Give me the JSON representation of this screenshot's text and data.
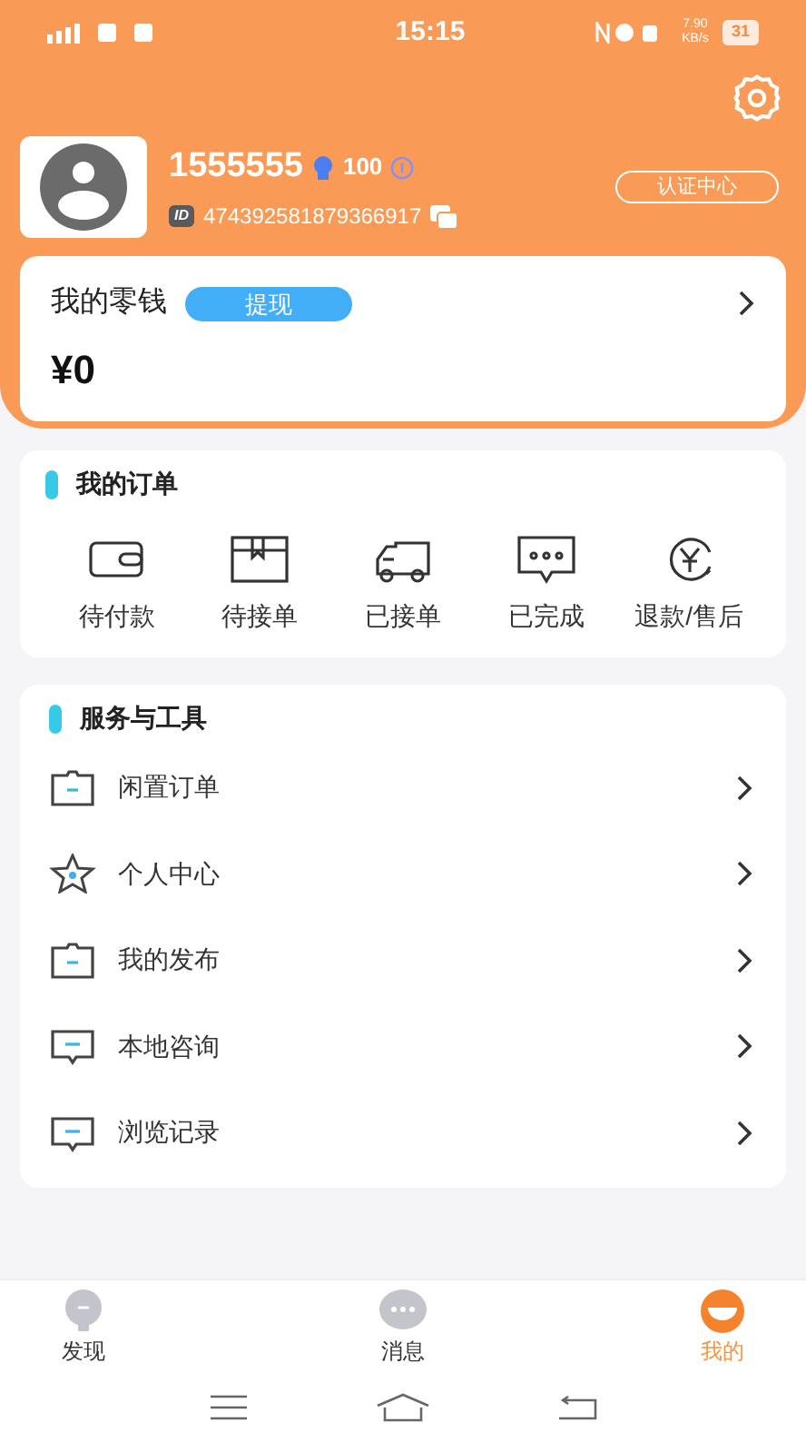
{
  "status_bar": {
    "time": "15:15",
    "speed": "7.90 KB/s",
    "battery": "31"
  },
  "profile": {
    "name": "1555555",
    "points": "100",
    "id_badge": "ID",
    "id": "474392581879366917",
    "cert_button": "认证中心"
  },
  "wallet": {
    "title": "我的零钱",
    "withdraw": "提现",
    "amount": "¥0"
  },
  "orders": {
    "title": "我的订单",
    "items": [
      {
        "kind": "wallet",
        "label": "待付款"
      },
      {
        "kind": "box",
        "label": "待接单"
      },
      {
        "kind": "truck",
        "label": "已接单"
      },
      {
        "kind": "chat",
        "label": "已完成"
      },
      {
        "kind": "refund",
        "label": "退款/售后"
      }
    ]
  },
  "services": {
    "title": "服务与工具",
    "items": [
      {
        "kind": "folder",
        "label": "闲置订单"
      },
      {
        "kind": "star",
        "label": "个人中心"
      },
      {
        "kind": "folder",
        "label": "我的发布"
      },
      {
        "kind": "message",
        "label": "本地咨询"
      },
      {
        "kind": "message",
        "label": "浏览记录"
      }
    ]
  },
  "tabs": [
    {
      "kind": "bulb",
      "label": "发现",
      "selected": false
    },
    {
      "kind": "chat",
      "label": "消息",
      "selected": false
    },
    {
      "kind": "smile",
      "label": "我的",
      "selected": true
    }
  ]
}
